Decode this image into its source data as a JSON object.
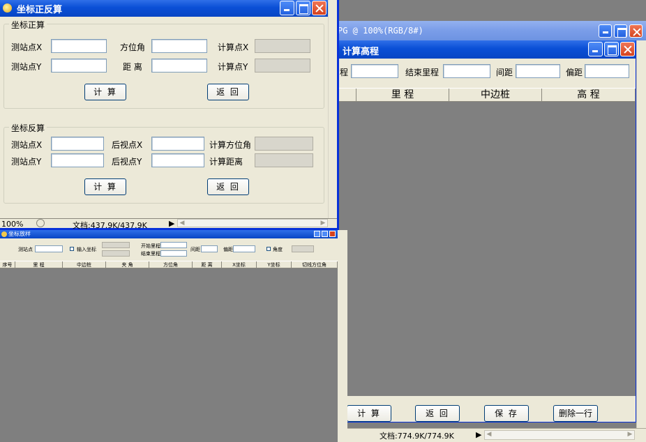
{
  "bg_app": {
    "title": "PG @ 100%(RGB/8#)"
  },
  "elev_window": {
    "title": "计算高程",
    "start_label": "程",
    "end_label": "结束里程",
    "interval_label": "间距",
    "offset_label": "偏距",
    "columns": [
      "",
      "里 程",
      "中边桩",
      "高 程"
    ],
    "buttons": {
      "calc": "计 算",
      "back": "返 回",
      "save": "保 存",
      "delete": "删除一行"
    },
    "status": {
      "doc": "文档:774.9K/774.9K"
    }
  },
  "coord_window": {
    "title": "坐标正反算",
    "forward": {
      "group_label": "坐标正算",
      "station_x": "测站点X",
      "station_y": "测站点Y",
      "azimuth": "方位角",
      "distance": "距 离",
      "calc_x": "计算点X",
      "calc_y": "计算点Y",
      "calc_button": "计 算",
      "back_button": "返 回"
    },
    "inverse": {
      "group_label": "坐标反算",
      "station_x": "测站点X",
      "station_y": "测站点Y",
      "back_x": "后视点X",
      "back_y": "后视点Y",
      "calc_azimuth": "计算方位角",
      "calc_distance": "计算距离",
      "calc_button": "计 算",
      "back_button": "返 回"
    },
    "status": {
      "zoom": "100%",
      "doc": "文档:437.9K/437.9K"
    }
  },
  "small_window": {
    "title": "坐标放样",
    "station_label": "测站点",
    "input_coord_label": "输入坐标",
    "start_label": "开始里程",
    "end_label": "结束里程",
    "interval_label": "间距",
    "offset_label": "偏距",
    "angle_label": "角度",
    "columns": [
      "序号",
      "里 程",
      "中边桩",
      "夹 角",
      "方位角",
      "距 离",
      "X坐标",
      "Y坐标",
      "切线方位角"
    ]
  },
  "colors": {
    "titlebar": "#0a4fd6",
    "window_bg": "#ece9d8",
    "workspace": "#7f7f7f",
    "close_button": "#d5431f"
  }
}
